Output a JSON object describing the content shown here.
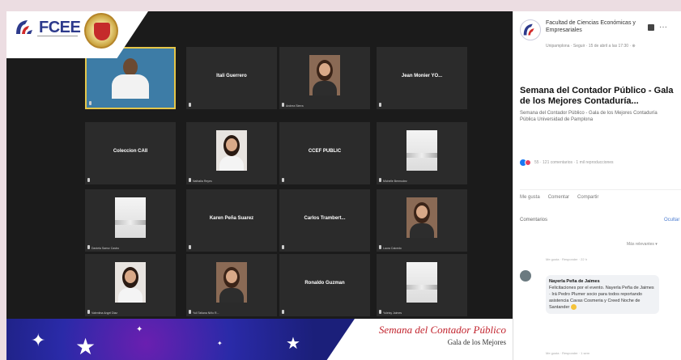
{
  "header": {
    "logo_text": "FCEE"
  },
  "tiles": [
    {
      "name": "",
      "caption": "",
      "kind": "video-male"
    },
    {
      "name": "Itali Guerrero",
      "caption": "",
      "kind": "name"
    },
    {
      "name": "",
      "caption": "Andrea Sierra",
      "kind": "female-dark"
    },
    {
      "name": "Jean Monier YO...",
      "caption": "",
      "kind": "name"
    },
    {
      "name": "Coleccion CAII",
      "caption": "",
      "kind": "name"
    },
    {
      "name": "",
      "caption": "Nathalia Reyes",
      "kind": "female-light"
    },
    {
      "name": "CCEF PUBLIC",
      "caption": "",
      "kind": "name"
    },
    {
      "name": "",
      "caption": "Michelle Bermudez",
      "kind": "plain"
    },
    {
      "name": "",
      "caption": "Daniela Saenz Castro",
      "kind": "plain"
    },
    {
      "name": "Karen Peña Suarez",
      "caption": "",
      "kind": "name"
    },
    {
      "name": "Carlos Trambert...",
      "caption": "",
      "kind": "name"
    },
    {
      "name": "",
      "caption": "Laura Caicedo",
      "kind": "female-dark"
    },
    {
      "name": "",
      "caption": "Valentina Angel Diaz",
      "kind": "female-light"
    },
    {
      "name": "",
      "caption": "Yuli Tatiana Niño R...",
      "kind": "female-dark"
    },
    {
      "name": "Ronaldo Guzman",
      "caption": "",
      "kind": "name"
    },
    {
      "name": "",
      "caption": "Yuleisy Jaimes",
      "kind": "plain"
    }
  ],
  "banner": {
    "title": "Semana del Contador Público",
    "subtitle": "Gala de los Mejores"
  },
  "sidebar": {
    "org": "Facultad de Ciencias Económicas y Empresariales",
    "meta": "Unipamplona · Seguir · 15 de abril a las 17:30 · ⊕",
    "more": "···",
    "title": "Semana del Contador Público - Gala de los Mejores Contaduría...",
    "desc": "Semana del Contador Público - Gala de los Mejores Contaduría Pública Universidad de Pamplona",
    "reactions": "55 · 121 comentarios · 1 mil reproducciones",
    "actions": [
      "Me gusta",
      "Comentar",
      "Compartir"
    ],
    "comments_label": "Comentarios",
    "comments_right": "Ocultar",
    "relevant": "Más relevantes ▾",
    "like_reply_1": "Me gusta · Responder · 22 h",
    "commenter": "Nayerla Peña de Jaimes",
    "comment_text": "Felicitaciones por el evento. Nayerla Peña de Jaimes · Irá Pedro Plumer socio para todos reportando asistencia Cavas Cosmeria y Creed Noche de Santander",
    "like_reply_2": "Me gusta · Responder · 1 sem"
  }
}
